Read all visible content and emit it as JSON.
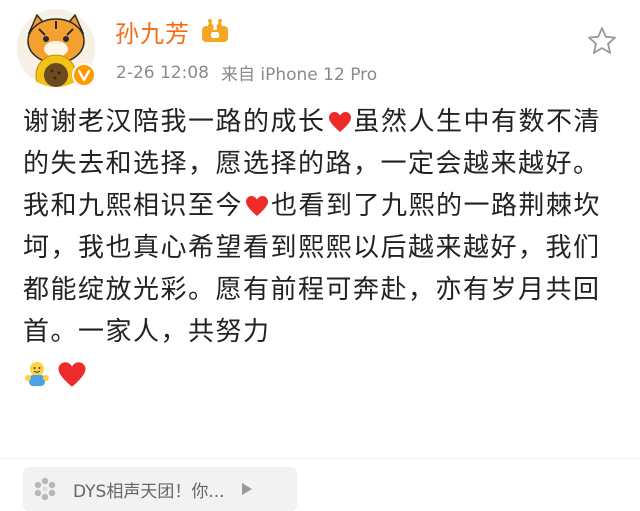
{
  "post": {
    "author": {
      "name": "孙九芳",
      "vip_icon": "member-crown-icon",
      "verified_icon": "verified-v-icon"
    },
    "meta": {
      "timestamp": "2-26 12:08",
      "source": "来自 iPhone 12 Pro"
    },
    "actions": {
      "favorite_icon": "star-outline-icon"
    },
    "body": {
      "p1": {
        "a": "谢谢老汉陪我一路的成长",
        "b": "虽然人生中有数不清的失去和选择，愿选择的路，一定会越来越好。"
      },
      "p2": {
        "a": "我和九熙相识至今",
        "b": "也看到了九熙的一路荆棘坎坷，我也真心希望看到熙熙以后越来越好，我们都能绽放光彩。愿有前程可奔赴，亦有岁月共回首。一家人，共努力"
      },
      "emojis": [
        "hug-emoji",
        "red-heart-emoji"
      ]
    },
    "topic": {
      "label": "DYS相声天团！你...",
      "icon": "topic-pinwheel-icon",
      "arrow_icon": "play-arrow-icon"
    }
  },
  "colors": {
    "username": "#f86b15",
    "heart": "#ee2b2b",
    "meta_text": "#8a8a8a",
    "verified_badge": "#ff9a00"
  }
}
